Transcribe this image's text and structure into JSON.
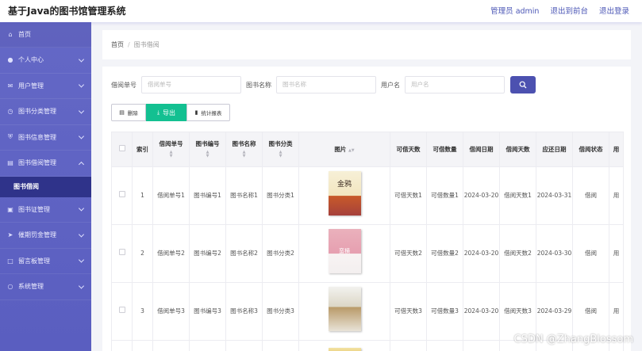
{
  "header": {
    "title": "基于Java的图书馆管理系统",
    "admin": "管理员 admin",
    "exit_front": "退出到前台",
    "logout": "退出登录"
  },
  "sidebar": {
    "items": [
      {
        "label": "首页",
        "icon": "home-icon"
      },
      {
        "label": "个人中心",
        "icon": "user-icon"
      },
      {
        "label": "用户管理",
        "icon": "mail-icon"
      },
      {
        "label": "图书分类管理",
        "icon": "clock-icon"
      },
      {
        "label": "图书信息管理",
        "icon": "shield-icon"
      },
      {
        "label": "图书借阅管理",
        "icon": "printer-icon"
      },
      {
        "label": "图书借阅",
        "icon": ""
      },
      {
        "label": "图书证管理",
        "icon": "card-icon"
      },
      {
        "label": "催期罚金管理",
        "icon": "send-icon"
      },
      {
        "label": "留言板管理",
        "icon": "message-icon"
      },
      {
        "label": "系统管理",
        "icon": "settings-icon"
      }
    ]
  },
  "breadcrumb": {
    "home": "首页",
    "separator": "/",
    "current": "图书借阅"
  },
  "search": {
    "f1_label": "借阅单号",
    "f1_placeholder": "借阅单号",
    "f2_label": "图书名称",
    "f2_placeholder": "图书名称",
    "f3_label": "用户名",
    "f3_placeholder": "用户名"
  },
  "actions": {
    "delete": "删除",
    "export": "导出",
    "stats": "统计报表"
  },
  "table": {
    "headers": [
      "",
      "索引",
      "借阅单号",
      "图书编号",
      "图书名称",
      "图书分类",
      "图片",
      "可借天数",
      "可借数量",
      "借阅日期",
      "借阅天数",
      "应还日期",
      "借阅状态",
      "用"
    ],
    "rows": [
      {
        "index": "1",
        "no": "借阅单号1",
        "book_no": "图书编号1",
        "name": "图书名称1",
        "cat": "图书分类1",
        "cover": "金鸦",
        "days": "可借天数1",
        "qty": "可借数量1",
        "date": "2024-03-20",
        "bdays": "借阅天数1",
        "due": "2024-03-31",
        "status": "借阅",
        "user": "用"
      },
      {
        "index": "2",
        "no": "借阅单号2",
        "book_no": "图书编号2",
        "name": "图书名称2",
        "cat": "图书分类2",
        "cover": "蛮横",
        "days": "可借天数2",
        "qty": "可借数量2",
        "date": "2024-03-20",
        "bdays": "借阅天数2",
        "due": "2024-03-30",
        "status": "借阅",
        "user": "用"
      },
      {
        "index": "3",
        "no": "借阅单号3",
        "book_no": "图书编号3",
        "name": "图书名称3",
        "cat": "图书分类3",
        "cover": "",
        "days": "可借天数3",
        "qty": "可借数量3",
        "date": "2024-03-20",
        "bdays": "借阅天数3",
        "due": "2024-03-29",
        "status": "借阅",
        "user": "用"
      }
    ]
  },
  "watermark": "CSDN @ZhangBlossom",
  "colors": {
    "sidebar": "#6468c6",
    "active_sub": "#2f338a",
    "primary": "#4c51b0",
    "export": "#13c091"
  }
}
